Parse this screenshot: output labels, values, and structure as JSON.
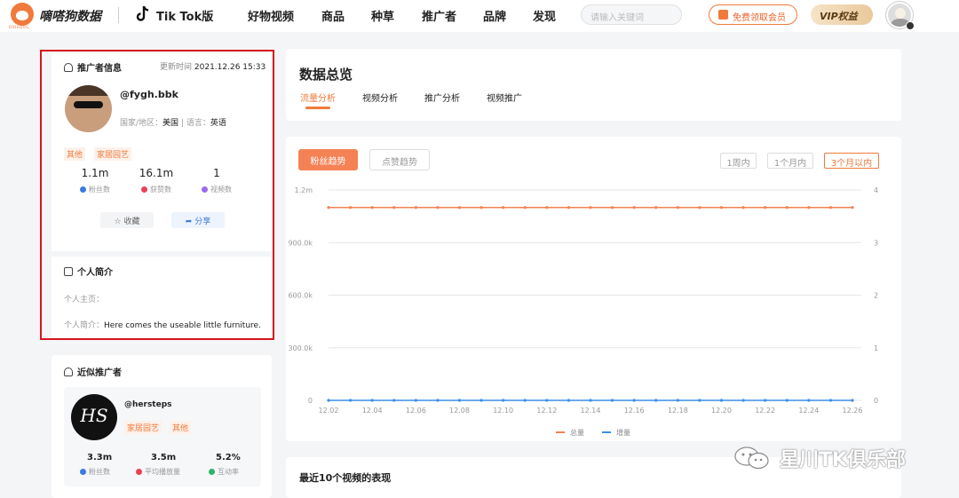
{
  "header": {
    "logo_text": "嘀嗒狗数据",
    "logo_sub": "DIDADOG",
    "platform": "Tik Tok版",
    "nav": [
      "好物视频",
      "商品",
      "种草",
      "推广者",
      "品牌",
      "发现"
    ],
    "search_placeholder": "请输入关键词",
    "free_vip": "免费领取会员",
    "vip": "VIP权益"
  },
  "profile": {
    "section_title": "推广者信息",
    "update_label": "更新时间",
    "update_time": "2021.12.26 15:33",
    "handle": "@fygh.bbk",
    "region_label": "国家/地区：",
    "region": "美国",
    "lang_label": "| 语言：",
    "language": "英语",
    "tags": [
      "其他",
      "家居园艺"
    ],
    "stats": [
      {
        "value": "1.1m",
        "label": "粉丝数",
        "color": "#3b7be0"
      },
      {
        "value": "16.1m",
        "label": "获赞数",
        "color": "#e8425a"
      },
      {
        "value": "1",
        "label": "视频数",
        "color": "#9b6be8"
      }
    ],
    "collect": "收藏",
    "share": "分享",
    "bio_title": "个人简介",
    "homepage_label": "个人主页：",
    "homepage": "",
    "bio_label": "个人简介：",
    "bio": "Here comes the useable little furniture."
  },
  "similar": {
    "title": "近似推广者",
    "avatar_text": "HS",
    "handle": "@hersteps",
    "tags": [
      "家居园艺",
      "其他"
    ],
    "stats": [
      {
        "value": "3.3m",
        "label": "粉丝数",
        "color": "#3b7be0"
      },
      {
        "value": "3.5m",
        "label": "平均播放量",
        "color": "#e8425a"
      },
      {
        "value": "5.2%",
        "label": "互动率",
        "color": "#2fb36a"
      }
    ]
  },
  "overview": {
    "title": "数据总览",
    "tabs": [
      "流量分析",
      "视频分析",
      "推广分析",
      "视频推广"
    ],
    "active_tab": 0
  },
  "chart_controls": {
    "metric_tabs": [
      "粉丝趋势",
      "点赞趋势"
    ],
    "ranges": [
      "1周内",
      "1个月内",
      "3个月以内"
    ],
    "active_range": 2
  },
  "chart_data": {
    "type": "line",
    "x": [
      "12.02",
      "12.04",
      "12.06",
      "12.08",
      "12.10",
      "12.12",
      "12.14",
      "12.16",
      "12.18",
      "12.20",
      "12.22",
      "12.24",
      "12.26"
    ],
    "y_left_ticks": [
      "1.2m",
      "900.0k",
      "600.0k",
      "300.0k",
      "0"
    ],
    "y_right_ticks": [
      "4",
      "3",
      "2",
      "1",
      "0"
    ],
    "ylim_left": [
      0,
      1200000
    ],
    "ylim_right": [
      0,
      4
    ],
    "series": [
      {
        "name": "总量",
        "color": "#f48255",
        "axis": "left",
        "value": 1100000
      },
      {
        "name": "增量",
        "color": "#3b8ee8",
        "axis": "right",
        "value": 0
      }
    ],
    "points_per_series": 25,
    "legend": "bottom",
    "grid": true
  },
  "recent": {
    "title": "最近10个视频的表现"
  },
  "watermark": {
    "text": "星川TK俱乐部"
  }
}
